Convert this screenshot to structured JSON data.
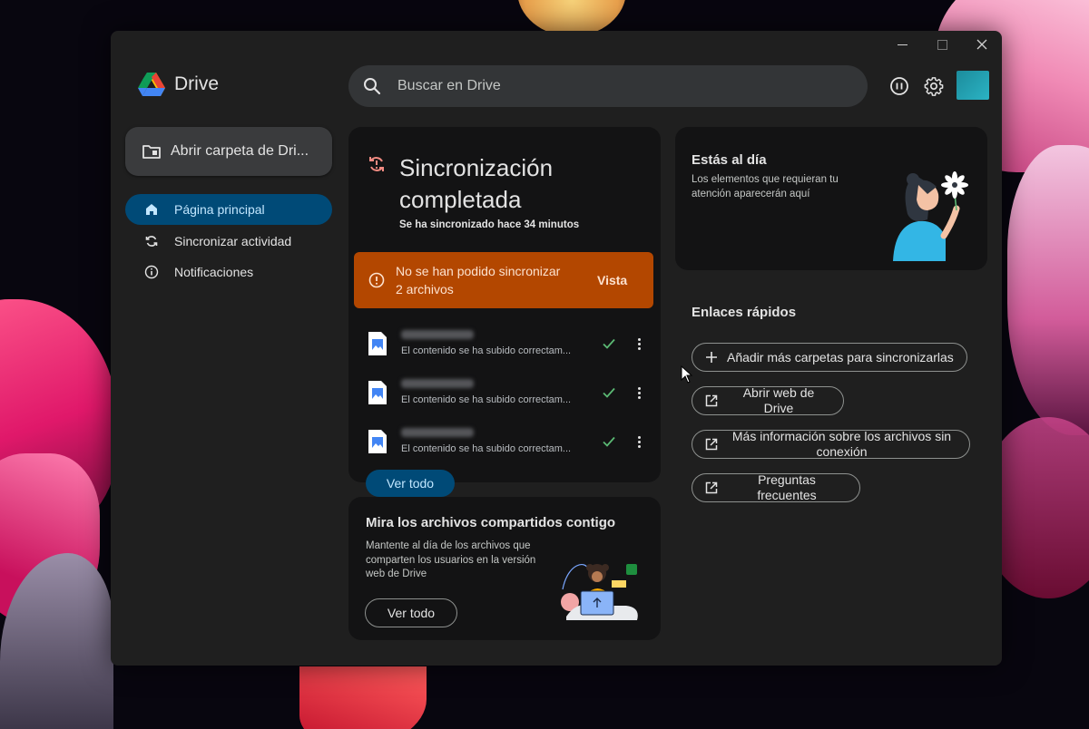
{
  "app": {
    "name": "Drive"
  },
  "window_controls": {
    "minimize": "minimize",
    "maximize": "maximize",
    "close": "close"
  },
  "search": {
    "placeholder": "Buscar en Drive"
  },
  "header_icons": {
    "pause": "pause-icon",
    "settings": "gear-icon"
  },
  "sidebar": {
    "open_folder_label": "Abrir carpeta de Dri...",
    "items": [
      {
        "label": "Página principal",
        "icon": "home-icon",
        "active": true
      },
      {
        "label": "Sincronizar actividad",
        "icon": "sync-icon",
        "active": false
      },
      {
        "label": "Notificaciones",
        "icon": "info-icon",
        "active": false
      }
    ]
  },
  "sync": {
    "title": "Sincronización completada",
    "subtitle": "Se ha sincronizado hace 34 minutos",
    "error": {
      "message": "No se han podido sincronizar 2 archivos",
      "action": "Vista"
    },
    "files": [
      {
        "status": "El contenido se ha subido correctam..."
      },
      {
        "status": "El contenido se ha subido correctam..."
      },
      {
        "status": "El contenido se ha subido correctam..."
      }
    ],
    "view_all": "Ver todo"
  },
  "shared": {
    "title": "Mira los archivos compartidos contigo",
    "description": "Mantente al día de los archivos que comparten los usuarios en la versión web de Drive",
    "button": "Ver todo"
  },
  "up_to_date": {
    "title": "Estás al día",
    "description": "Los elementos que requieran tu atención aparecerán aquí"
  },
  "quick_links": {
    "title": "Enlaces rápidos",
    "add_folders": "Añadir más carpetas para sincronizarlas",
    "open_web": "Abrir web de Drive",
    "offline_info": "Más información sobre los archivos sin conexión",
    "faq": "Preguntas frecuentes"
  },
  "colors": {
    "active_nav": "#004a77",
    "error_bar": "#b34700",
    "check": "#5bb974"
  }
}
